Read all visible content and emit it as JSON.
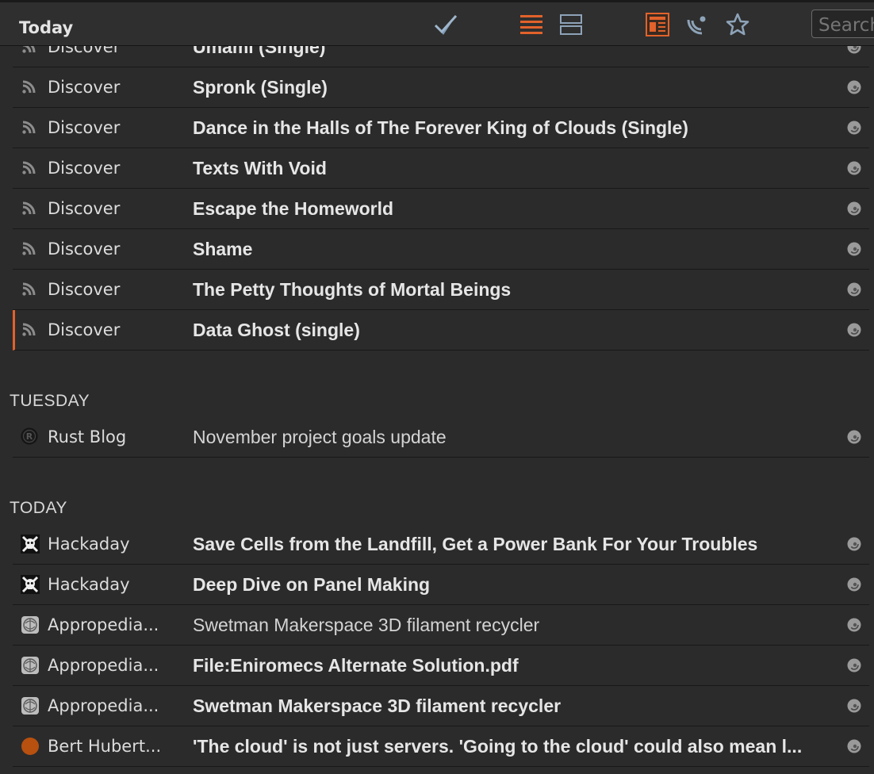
{
  "toolbar": {
    "title": "Today",
    "search_placeholder": "Search",
    "accent": "#e2622b",
    "icons": [
      "checkmark-icon",
      "list-view-icon",
      "split-view-icon",
      "article-view-icon",
      "satellite-icon",
      "star-icon"
    ]
  },
  "groups": [
    {
      "label": "",
      "items": [
        {
          "feed": "Discover",
          "icon": "rss-icon",
          "title": "Umami (Single)",
          "unread": true
        },
        {
          "feed": "Discover",
          "icon": "rss-icon",
          "title": "Spronk (Single)",
          "unread": true
        },
        {
          "feed": "Discover",
          "icon": "rss-icon",
          "title": "Dance in the Halls of The Forever King of Clouds (Single)",
          "unread": true
        },
        {
          "feed": "Discover",
          "icon": "rss-icon",
          "title": "Texts With Void",
          "unread": true
        },
        {
          "feed": "Discover",
          "icon": "rss-icon",
          "title": "Escape the Homeworld",
          "unread": true
        },
        {
          "feed": "Discover",
          "icon": "rss-icon",
          "title": "Shame",
          "unread": true
        },
        {
          "feed": "Discover",
          "icon": "rss-icon",
          "title": "The Petty Thoughts of Mortal Beings",
          "unread": true
        },
        {
          "feed": "Discover",
          "icon": "rss-icon",
          "title": "Data Ghost (single)",
          "unread": true,
          "selected": true
        }
      ]
    },
    {
      "label": "TUESDAY",
      "items": [
        {
          "feed": "Rust Blog",
          "icon": "rust-logo-icon",
          "title": "November project goals update",
          "unread": false
        }
      ]
    },
    {
      "label": "TODAY",
      "items": [
        {
          "feed": "Hackaday",
          "icon": "skull-crossbones-icon",
          "title": "Save Cells from the Landfill, Get a Power Bank For Your Troubles",
          "unread": true
        },
        {
          "feed": "Hackaday",
          "icon": "skull-crossbones-icon",
          "title": "Deep Dive on Panel Making",
          "unread": true
        },
        {
          "feed": "Appropedia...",
          "icon": "appropedia-logo-icon",
          "title": "Swetman Makerspace 3D filament recycler",
          "unread": false
        },
        {
          "feed": "Appropedia...",
          "icon": "appropedia-logo-icon",
          "title": "File:Eniromecs Alternate Solution.pdf",
          "unread": true
        },
        {
          "feed": "Appropedia...",
          "icon": "appropedia-logo-icon",
          "title": "Swetman Makerspace 3D filament recycler",
          "unread": true
        },
        {
          "feed": "Bert Hubert...",
          "icon": "orange-circle-icon",
          "title": "'The cloud' is not just servers. 'Going to the cloud' could also mean l...",
          "unread": true
        }
      ]
    }
  ]
}
